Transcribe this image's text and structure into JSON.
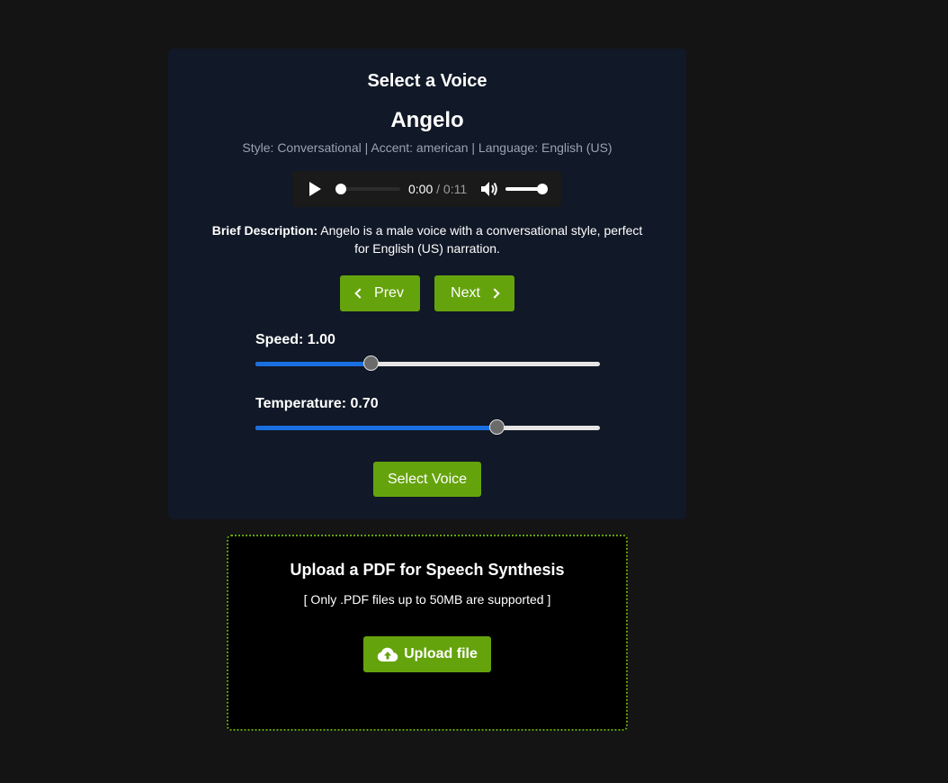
{
  "voice_panel": {
    "title": "Select a Voice",
    "voice_name": "Angelo",
    "meta": "Style: Conversational | Accent: american | Language: English (US)",
    "audio": {
      "current_time": "0:00",
      "duration_text": "/ 0:11",
      "progress": 0,
      "volume": 1
    },
    "description_label": "Brief Description:",
    "description_text": " Angelo is a male voice with a conversational style, perfect for English (US) narration.",
    "prev_label": "Prev",
    "next_label": "Next",
    "speed": {
      "label": "Speed: 1.00",
      "value": 1.0,
      "min": 0.5,
      "max": 2.0
    },
    "temperature": {
      "label": "Temperature: 0.70",
      "value": 0.7,
      "min": 0.0,
      "max": 1.0
    },
    "select_label": "Select Voice"
  },
  "upload": {
    "title": "Upload a PDF for Speech Synthesis",
    "note": "[ Only .PDF files up to 50MB are supported ]",
    "button_label": "Upload file",
    "button_icon": "cloud-upload-icon"
  },
  "colors": {
    "page_bg": "#141414",
    "panel_bg": "#111827",
    "accent_green": "#65a30d",
    "slider_fill": "#1a6fe0"
  }
}
